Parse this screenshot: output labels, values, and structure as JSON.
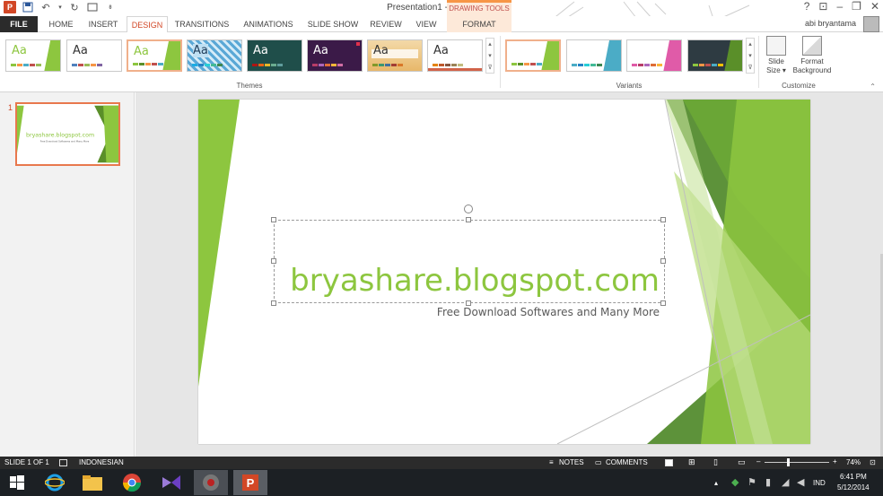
{
  "window": {
    "title": "Presentation1 - PowerPoint",
    "contextual_tab_group": "DRAWING TOOLS",
    "controls": [
      "?",
      "⊡",
      "–",
      "❐",
      "✕"
    ]
  },
  "user": {
    "name": "abi bryantama"
  },
  "tabs": [
    "FILE",
    "HOME",
    "INSERT",
    "DESIGN",
    "TRANSITIONS",
    "ANIMATIONS",
    "SLIDE SHOW",
    "REVIEW",
    "VIEW",
    "FORMAT"
  ],
  "active_tab": "DESIGN",
  "ribbon": {
    "groups": {
      "themes": "Themes",
      "variants": "Variants",
      "customize": "Customize"
    },
    "theme_sample_text": "Aa",
    "slide_size": {
      "line1": "Slide",
      "line2": "Size ▾"
    },
    "format_background": {
      "line1": "Format",
      "line2": "Background"
    }
  },
  "theme_colors": {
    "accent": "#d24726",
    "facet_green": "#8dc63f",
    "dark_green": "#5a8f29",
    "orange_tab": "#f79646"
  },
  "slide_pane": {
    "slide_number": "1"
  },
  "slide": {
    "title": "bryashare.blogspot.com",
    "subtitle": "Free Download Softwares and Many More"
  },
  "status_bar": {
    "slide_indicator": "SLIDE 1 OF 1",
    "language": "INDONESIAN",
    "notes": "NOTES",
    "comments": "COMMENTS",
    "zoom": "74%",
    "zoom_minus": "–",
    "zoom_plus": "+",
    "zoom_level": 0.74
  },
  "taskbar": {
    "apps": [
      "windows-start",
      "internet-explorer",
      "file-explorer",
      "chrome",
      "visual-studio",
      "media-app",
      "powerpoint"
    ],
    "tray_language": "IND",
    "time": "6:41 PM",
    "date": "5/12/2014"
  }
}
